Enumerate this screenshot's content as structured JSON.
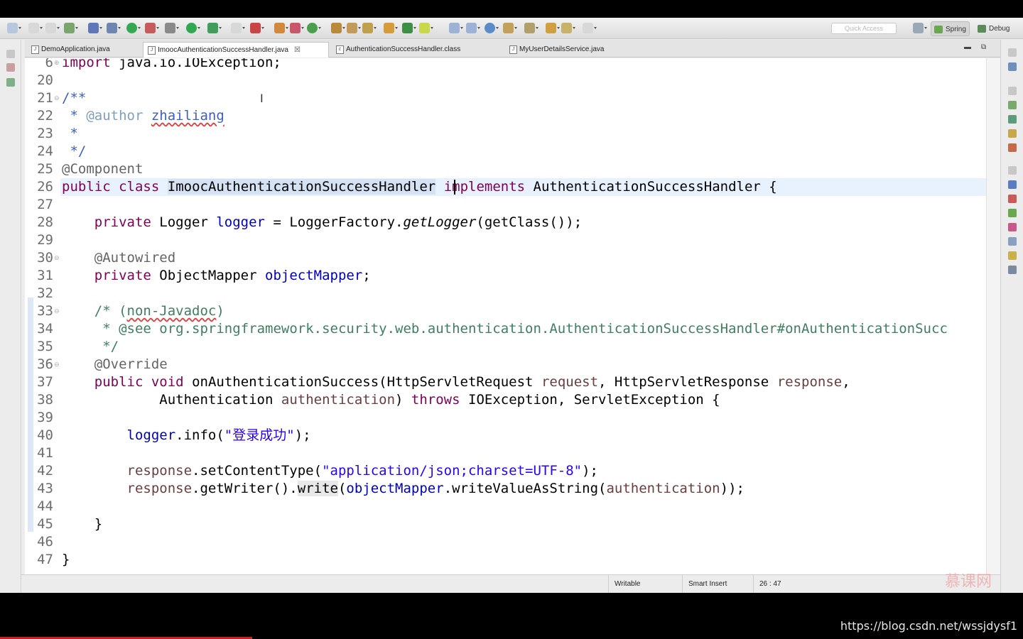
{
  "toolbar": {
    "quick_access_placeholder": "Quick Access",
    "perspectives": [
      {
        "label": "Spring",
        "icon": "spring-leaf-icon",
        "active": true
      },
      {
        "label": "Debug",
        "icon": "bug-icon",
        "active": false
      }
    ]
  },
  "tabs": [
    {
      "label": "DemoApplication.java",
      "icon": "java-file-icon",
      "active": false
    },
    {
      "label": "ImoocAuthenticationSuccessHandler.java",
      "icon": "java-file-icon",
      "active": true,
      "close": "☒"
    },
    {
      "label": "AuthenticationSuccessHandler.class",
      "icon": "class-file-icon",
      "active": false
    },
    {
      "label": "MyUserDetailsService.java",
      "icon": "java-file-icon",
      "active": false
    }
  ],
  "editor": {
    "line_numbers": [
      "6",
      "20",
      "21",
      "22",
      "23",
      "24",
      "25",
      "26",
      "27",
      "28",
      "29",
      "30",
      "31",
      "32",
      "33",
      "34",
      "35",
      "36",
      "37",
      "38",
      "39",
      "40",
      "41",
      "42",
      "43",
      "44",
      "45",
      "46",
      "47"
    ],
    "line6": {
      "kw": "import",
      "rest": " java.io.IOException;"
    },
    "line21": "/**",
    "line22": {
      "star": " * ",
      "tag": "@author",
      "name": "zhailiang"
    },
    "line23": " *",
    "line24": " */",
    "line25": "@Component",
    "line26": {
      "kw1": "public",
      "kw2": "class",
      "class_name": "ImoocAuthenticationSuccessHandler",
      "kw3": "implements",
      "iface": "AuthenticationSuccessHandler {"
    },
    "line28": {
      "kw": "private",
      "type": " Logger ",
      "field": "logger",
      "mid": " = LoggerFactory.",
      "method": "getLogger",
      "tail": "(getClass());"
    },
    "line30": "@Autowired",
    "line31": {
      "kw": "private",
      "type": " ObjectMapper ",
      "field": "objectMapper",
      "tail": ";"
    },
    "line33": {
      "open": "/* (",
      "word": "non-Javadoc",
      "close": ")"
    },
    "line34": {
      "star": " * ",
      "tag": "@see",
      "ref": " org.springframework.security.web.authentication.AuthenticationSuccessHandler#onAuthenticationSucc"
    },
    "line35": " */",
    "line36": "@Override",
    "line37": {
      "kw1": "public",
      "kw2": "void",
      "sig": " onAuthenticationSuccess(HttpServletRequest ",
      "p1": "request",
      "mid": ", HttpServletResponse ",
      "p2": "response",
      "tail": ","
    },
    "line38": {
      "type": "Authentication ",
      "p": "authentication",
      "paren": ") ",
      "kw": "throws",
      "tail": " IOException, ServletException {"
    },
    "line40": {
      "field": "logger",
      "mid": ".info(",
      "str": "\"登录成功\"",
      "tail": ");"
    },
    "line42": {
      "p": "response",
      "mid": ".setContentType(",
      "str": "\"application/json;charset=UTF-8\"",
      "tail": ");"
    },
    "line43": {
      "p": "response",
      "mid": ".getWriter().",
      "write": "write",
      "paren": "(",
      "field": "objectMapper",
      "mid2": ".writeValueAsString(",
      "p2": "authentication",
      "tail": "));"
    },
    "line45": "}",
    "line47": "}"
  },
  "status": {
    "writable": "Writable",
    "insert_mode": "Smart Insert",
    "position": "26 : 47"
  },
  "watermark": "慕课网",
  "footer_url": "https://blog.csdn.net/wssjdysf1"
}
